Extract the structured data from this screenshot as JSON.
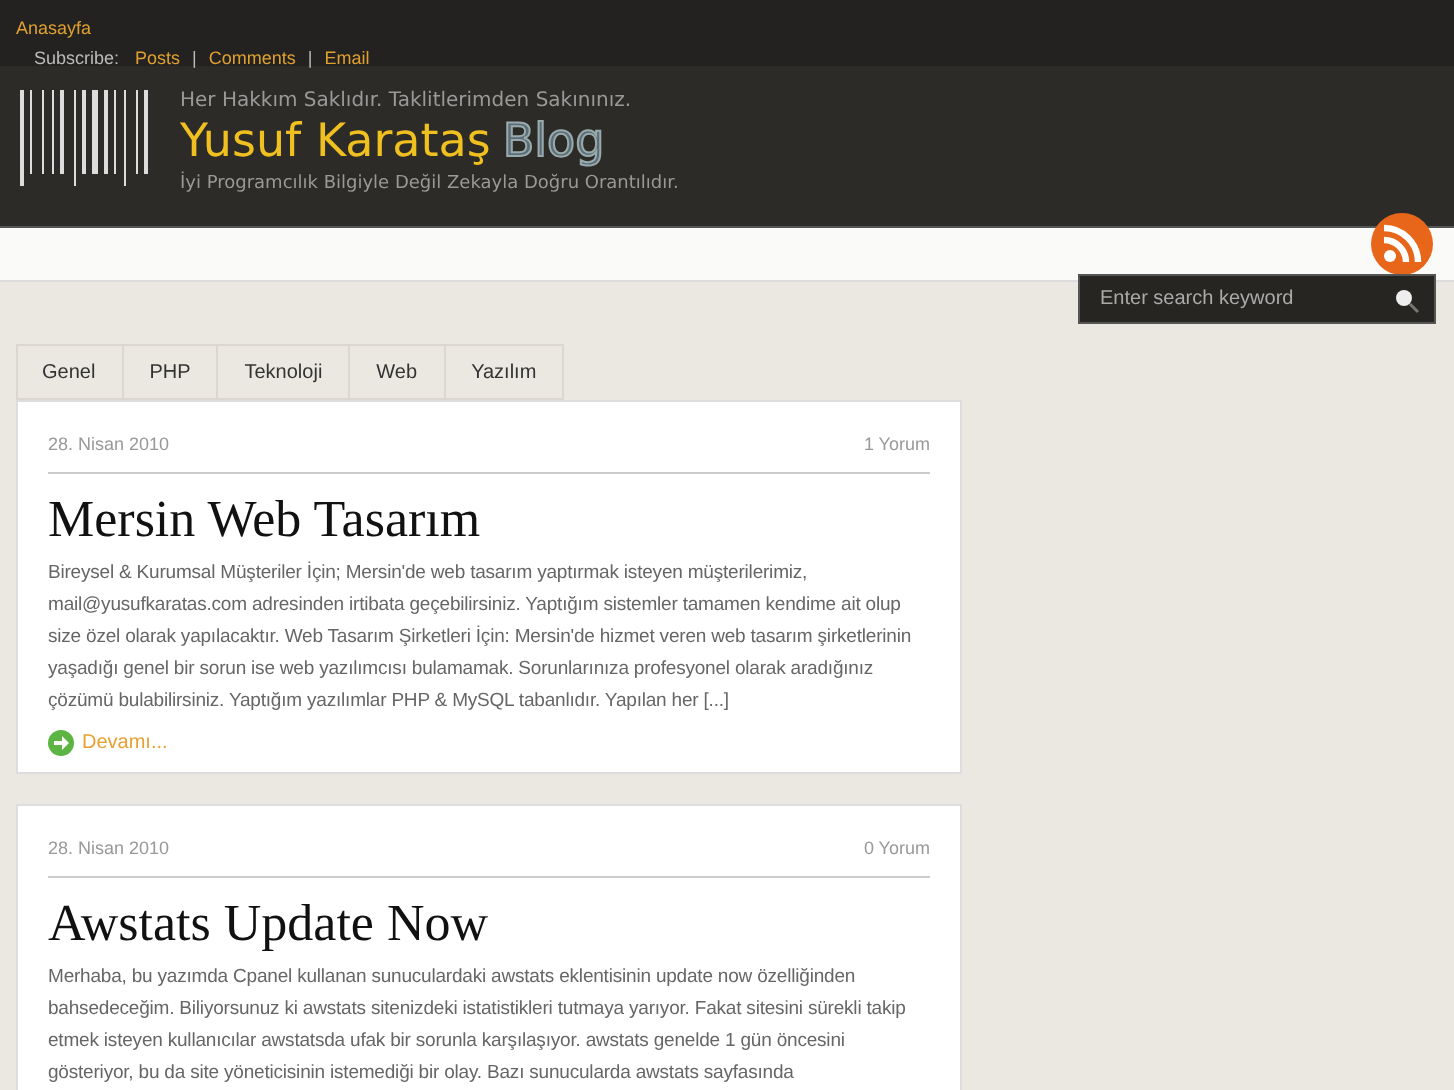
{
  "top_nav": {
    "home": "Anasayfa",
    "subscribe_label": "Subscribe:",
    "links": [
      "Posts",
      "Comments",
      "Email"
    ],
    "separator": "|"
  },
  "header": {
    "tagline": "Her Hakkım Saklıdır. Taklitlerimden Sakınınız.",
    "title": "Yusuf Karataş",
    "title_suffix": "Blog",
    "subtitle": "İyi Programcılık Bilgiyle Değil Zekayla Doğru Orantılıdır."
  },
  "search": {
    "placeholder": "Enter search keyword"
  },
  "categories": [
    {
      "label": "Genel"
    },
    {
      "label": "PHP"
    },
    {
      "label": "Teknoloji"
    },
    {
      "label": "Web"
    },
    {
      "label": "Yazılım"
    }
  ],
  "posts": [
    {
      "date": "28. Nisan 2010",
      "comments": "1 Yorum",
      "title": "Mersin Web Tasarım",
      "body": "Bireysel & Kurumsal Müşteriler İçin; Mersin'de web tasarım yaptırmak isteyen müşterilerimiz, mail@yusufkaratas.com adresinden irtibata geçebilirsiniz.  Yaptığım sistemler tamamen kendime ait olup size özel olarak yapılacaktır. Web Tasarım Şirketleri İçin: Mersin'de hizmet veren web tasarım şirketlerinin yaşadığı genel bir sorun ise web yazılımcısı bulamamak.  Sorunlarınıza profesyonel olarak aradığınız çözümü bulabilirsiniz. Yaptığım yazılımlar PHP & MySQL tabanlıdır. Yapılan her [...]",
      "more": "Devamı..."
    },
    {
      "date": "28. Nisan 2010",
      "comments": "0 Yorum",
      "title": "Awstats Update Now",
      "body": "Merhaba, bu yazımda Cpanel kullanan sunuculardaki awstats eklentisinin update now özelliğinden bahsedeceğim. Biliyorsunuz ki awstats sitenizdeki istatistikleri tutmaya yarıyor.  Fakat sitesini sürekli takip etmek isteyen kullanıcılar awstatsda ufak bir sorunla karşılaşıyor.  awstats genelde 1 gün öncesini gösteriyor, bu da site yöneticisinin istemediği bir olay. Bazı sunucularda awstats sayfasında"
    }
  ]
}
